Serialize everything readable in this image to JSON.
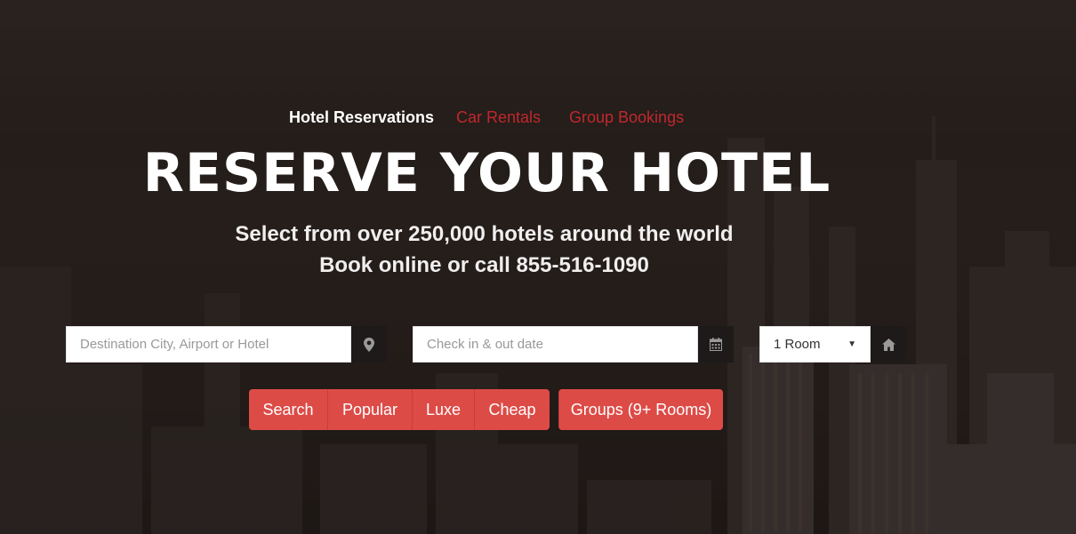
{
  "tabs": [
    {
      "label": "Hotel Reservations",
      "active": true
    },
    {
      "label": "Car Rentals",
      "active": false
    },
    {
      "label": "Group Bookings",
      "active": false
    }
  ],
  "hero": {
    "title": "RESERVE YOUR HOTEL",
    "subtitle_line1": "Select from over 250,000 hotels around the world",
    "subtitle_line2": "Book online or call 855-516-1090"
  },
  "form": {
    "destination_placeholder": "Destination City, Airport or Hotel",
    "destination_icon": "map-marker-icon",
    "dates_placeholder": "Check in & out date",
    "dates_icon": "calendar-icon",
    "rooms_value": "1 Room",
    "rooms_icon": "home-icon"
  },
  "buttons": {
    "search": "Search",
    "popular": "Popular",
    "luxe": "Luxe",
    "cheap": "Cheap",
    "groups": "Groups (9+ Rooms)"
  },
  "colors": {
    "accent": "#dd4b47",
    "inactive_tab": "#c0282e",
    "text_light": "#ffffff"
  }
}
